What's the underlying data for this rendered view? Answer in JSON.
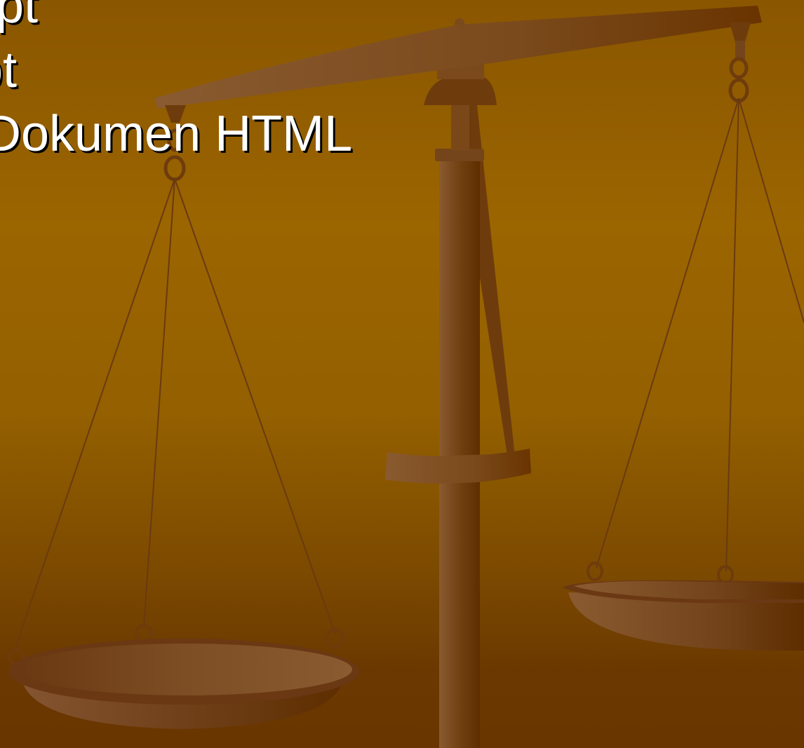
{
  "slide": {
    "text_lines": [
      "Script",
      "ipt",
      "Dokumen HTML"
    ],
    "illustration": "balance-scale-icon",
    "colors": {
      "background_top": "#8a5600",
      "background_mid": "#9b6500",
      "background_bottom": "#6a3600",
      "wood_light": "#8a5a30",
      "wood_dark": "#5e2e00",
      "text": "#ffffff",
      "text_shadow": "#000000"
    }
  }
}
